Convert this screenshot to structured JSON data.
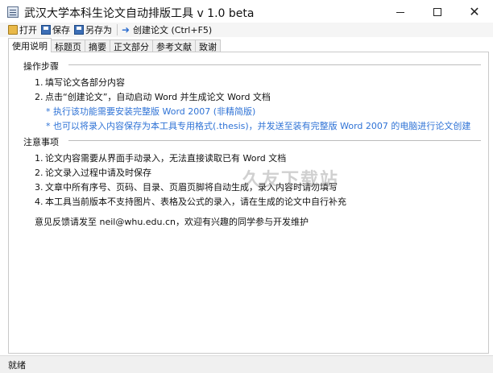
{
  "window": {
    "title": "武汉大学本科生论文自动排版工具 v 1.0 beta",
    "controls": [
      "minimize",
      "maximize",
      "close"
    ]
  },
  "toolbar": {
    "open_label": "打开",
    "save_label": "保存",
    "saveas_label": "另存为",
    "create_label": "创建论文 (Ctrl+F5)"
  },
  "tabs": [
    {
      "label": "使用说明",
      "active": true
    },
    {
      "label": "标题页",
      "active": false
    },
    {
      "label": "摘要",
      "active": false
    },
    {
      "label": "正文部分",
      "active": false
    },
    {
      "label": "参考文献",
      "active": false
    },
    {
      "label": "致谢",
      "active": false
    }
  ],
  "instructions": {
    "steps_heading": "操作步骤",
    "steps": [
      {
        "num": "1.",
        "text": "填写论文各部分内容"
      },
      {
        "num": "2.",
        "text": "点击“创建论文”，自动启动 Word 并生成论文 Word 文档"
      }
    ],
    "step_notes": [
      "* 执行该功能需要安装完整版 Word 2007 (非精简版)",
      "* 也可以将录入内容保存为本工具专用格式(.thesis)，并发送至装有完整版 Word 2007 的电脑进行论文创建"
    ],
    "notes_heading": "注意事项",
    "notes": [
      {
        "num": "1.",
        "text": "论文内容需要从界面手动录入，无法直接读取已有 Word 文档"
      },
      {
        "num": "2.",
        "text": "论文录入过程中请及时保存"
      },
      {
        "num": "3.",
        "text": "文章中所有序号、页码、目录、页眉页脚将自动生成，录入内容时请勿填写"
      },
      {
        "num": "4.",
        "text": "本工具当前版本不支持图片、表格及公式的录入，请在生成的论文中自行补充"
      }
    ],
    "feedback": "意见反馈请发至 neil@whu.edu.cn，欢迎有兴趣的同学参与开发维护"
  },
  "watermark": "久友下载站",
  "status": {
    "text": "就绪"
  },
  "colors": {
    "link_blue": "#2f73d6",
    "border": "#c9c9c9"
  }
}
